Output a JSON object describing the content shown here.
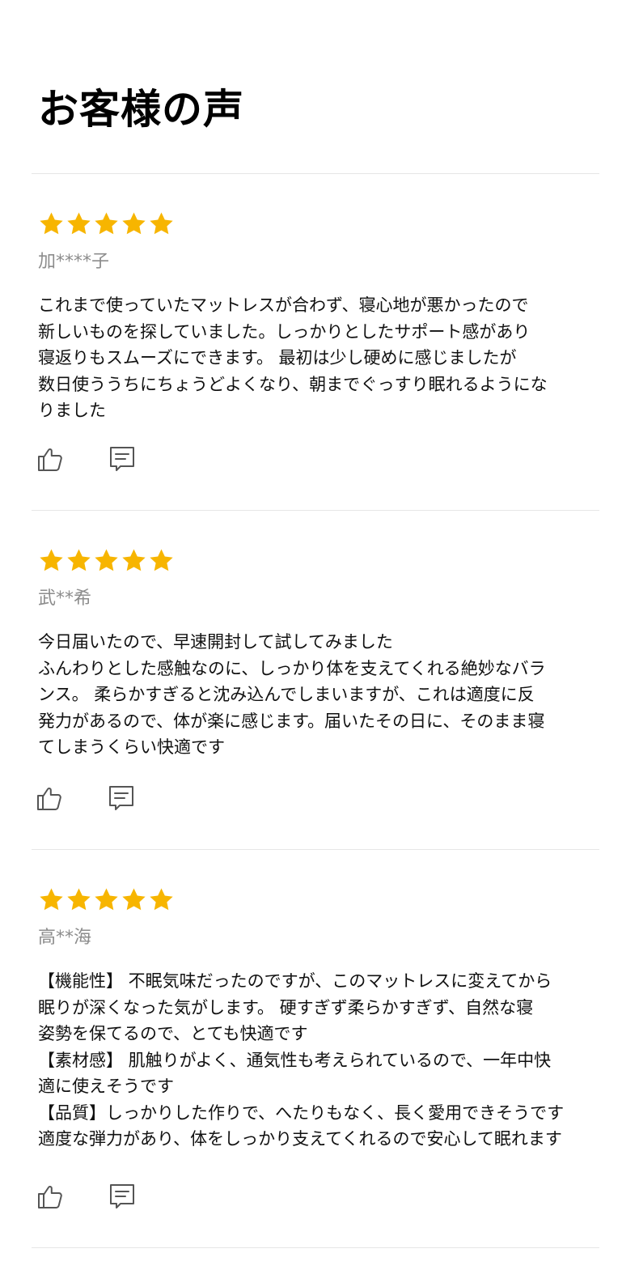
{
  "page": {
    "title": "お客様の声"
  },
  "colors": {
    "star": "#F7B500",
    "divider": "#E6E6E6",
    "author": "#8C8C8C",
    "icon": "#555555"
  },
  "reviews": [
    {
      "rating": 5,
      "author": "加****子",
      "text": "これまで使っていたマットレスが合わず、寝心地が悪かったので\n新しいものを探していました。しっかりとしたサポート感があり\n寝返りもスムーズにできます。 最初は少し硬めに感じましたが\n数日使ううちにちょうどよくなり、朝までぐっすり眠れるようにな\nりました",
      "like_icon": "thumbs-up-icon",
      "comment_icon": "comment-icon"
    },
    {
      "rating": 5,
      "author": "武**希",
      "text": "今日届いたので、早速開封して試してみました\nふんわりとした感触なのに、しっかり体を支えてくれる絶妙なバラ\nンス。 柔らかすぎると沈み込んでしまいますが、これは適度に反\n発力があるので、体が楽に感じます。届いたその日に、そのまま寝\nてしまうくらい快適です",
      "like_icon": "thumbs-up-icon",
      "comment_icon": "comment-icon"
    },
    {
      "rating": 5,
      "author": "高**海",
      "text": "【機能性】 不眠気味だったのですが、このマットレスに変えてから\n眠りが深くなった気がします。 硬すぎず柔らかすぎず、自然な寝\n姿勢を保てるので、とても快適です\n【素材感】 肌触りがよく、通気性も考えられているので、一年中快\n適に使えそうです\n【品質】しっかりした作りで、へたりもなく、長く愛用できそうです\n適度な弾力があり、体をしっかり支えてくれるので安心して眠れます",
      "like_icon": "thumbs-up-icon",
      "comment_icon": "comment-icon"
    }
  ]
}
